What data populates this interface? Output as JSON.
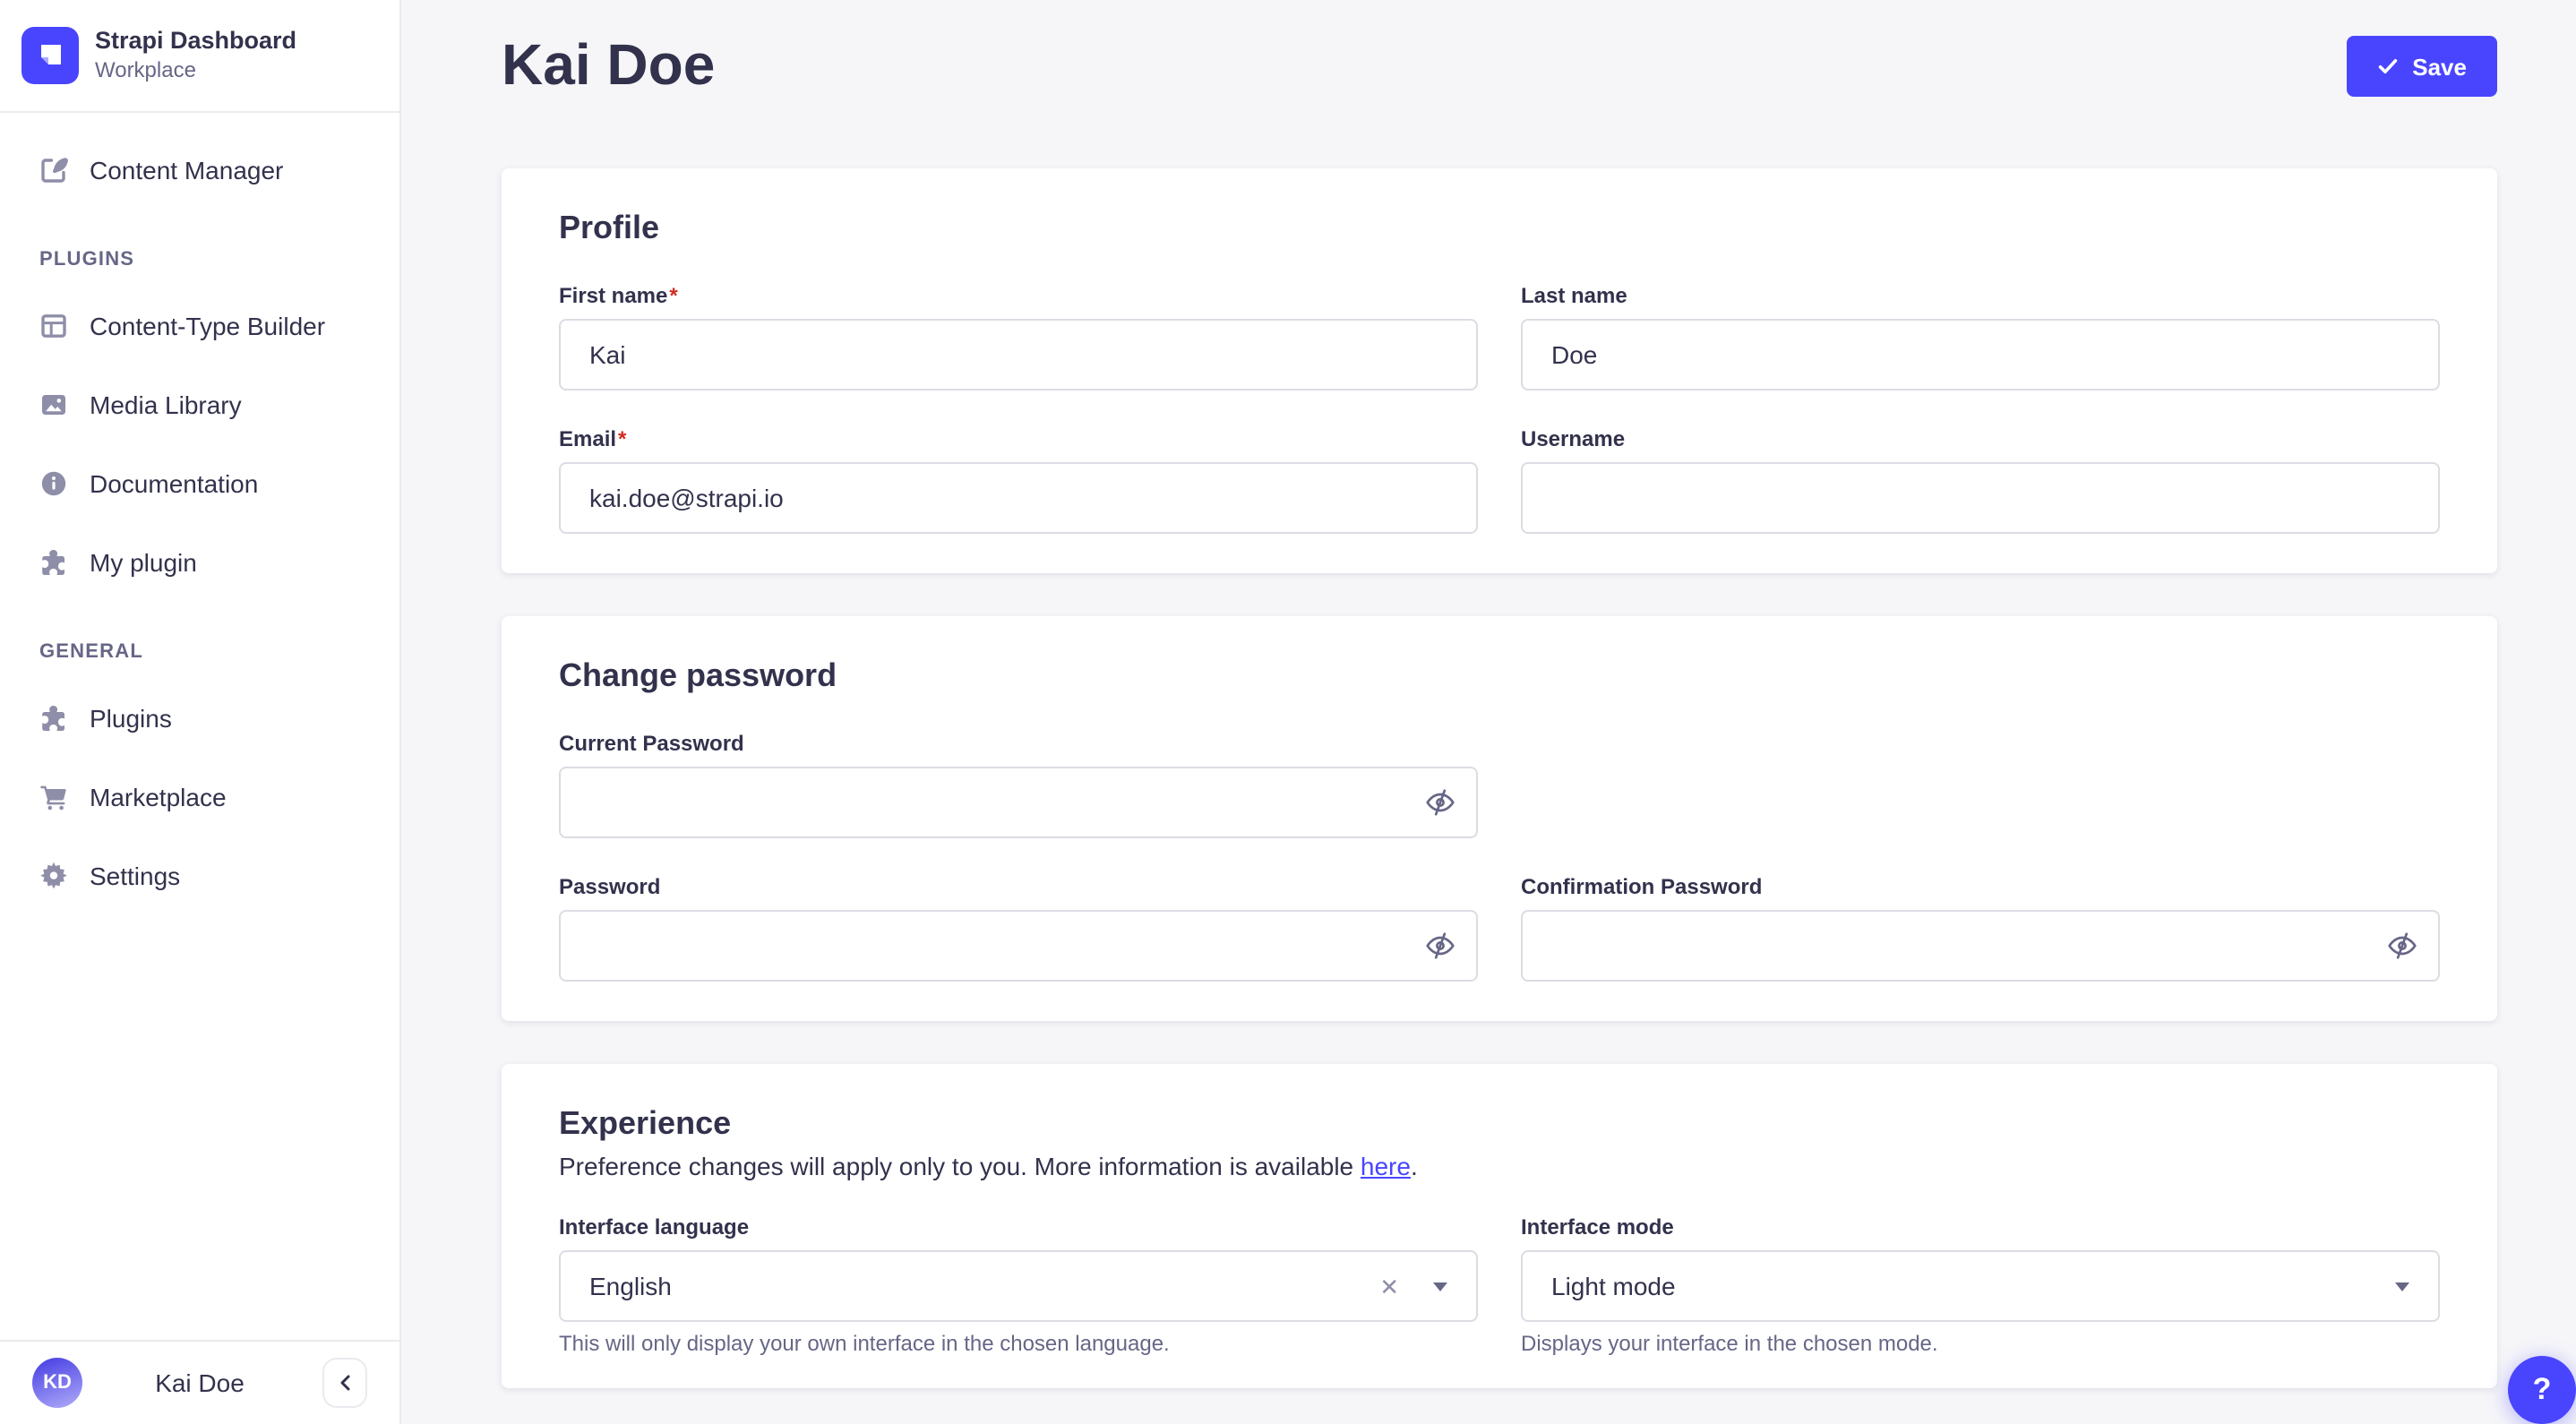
{
  "colors": {
    "accent": "#4945FF",
    "danger": "#D02B20",
    "text": "#32324D",
    "muted": "#666687",
    "icon": "#8E8EA9",
    "border": "#EAEAEF",
    "input_border": "#DCDCE4",
    "background": "#F6F6F9"
  },
  "required_mark": "*",
  "sidebar": {
    "brand": {
      "title": "Strapi Dashboard",
      "subtitle": "Workplace",
      "logo_icon": "strapi-logo-icon"
    },
    "content_manager": {
      "label": "Content Manager",
      "icon": "content-manager-icon"
    },
    "sections": [
      {
        "header": "PLUGINS",
        "items": [
          {
            "label": "Content-Type Builder",
            "icon": "content-type-builder-icon"
          },
          {
            "label": "Media Library",
            "icon": "media-library-icon"
          },
          {
            "label": "Documentation",
            "icon": "documentation-icon"
          },
          {
            "label": "My plugin",
            "icon": "puzzle-icon"
          }
        ]
      },
      {
        "header": "GENERAL",
        "items": [
          {
            "label": "Plugins",
            "icon": "puzzle-icon"
          },
          {
            "label": "Marketplace",
            "icon": "cart-icon"
          },
          {
            "label": "Settings",
            "icon": "gear-icon"
          }
        ]
      }
    ],
    "user": {
      "initials": "KD",
      "name": "Kai Doe"
    },
    "collapse_icon": "chevron-left-icon"
  },
  "header": {
    "title": "Kai Doe",
    "save_label": "Save",
    "save_icon": "check-icon"
  },
  "profile_card": {
    "title": "Profile",
    "fields": {
      "first_name": {
        "label": "First name",
        "required": true,
        "value": "Kai"
      },
      "last_name": {
        "label": "Last name",
        "required": false,
        "value": "Doe"
      },
      "email": {
        "label": "Email",
        "required": true,
        "value": "kai.doe@strapi.io"
      },
      "username": {
        "label": "Username",
        "required": false,
        "value": ""
      }
    }
  },
  "password_card": {
    "title": "Change password",
    "visibility_icon": "eye-off-icon",
    "fields": {
      "current": {
        "label": "Current Password",
        "value": ""
      },
      "new": {
        "label": "Password",
        "value": ""
      },
      "confirm": {
        "label": "Confirmation Password",
        "value": ""
      }
    }
  },
  "experience_card": {
    "title": "Experience",
    "description": {
      "prefix": "Preference changes will apply only to you. More information is available ",
      "link": "here",
      "suffix": "."
    },
    "language": {
      "label": "Interface language",
      "value": "English",
      "clear": "✕",
      "helper": "This will only display your own interface in the chosen language."
    },
    "mode": {
      "label": "Interface mode",
      "value": "Light mode",
      "helper": "Displays your interface in the chosen mode."
    }
  },
  "help_button": {
    "label": "?"
  }
}
